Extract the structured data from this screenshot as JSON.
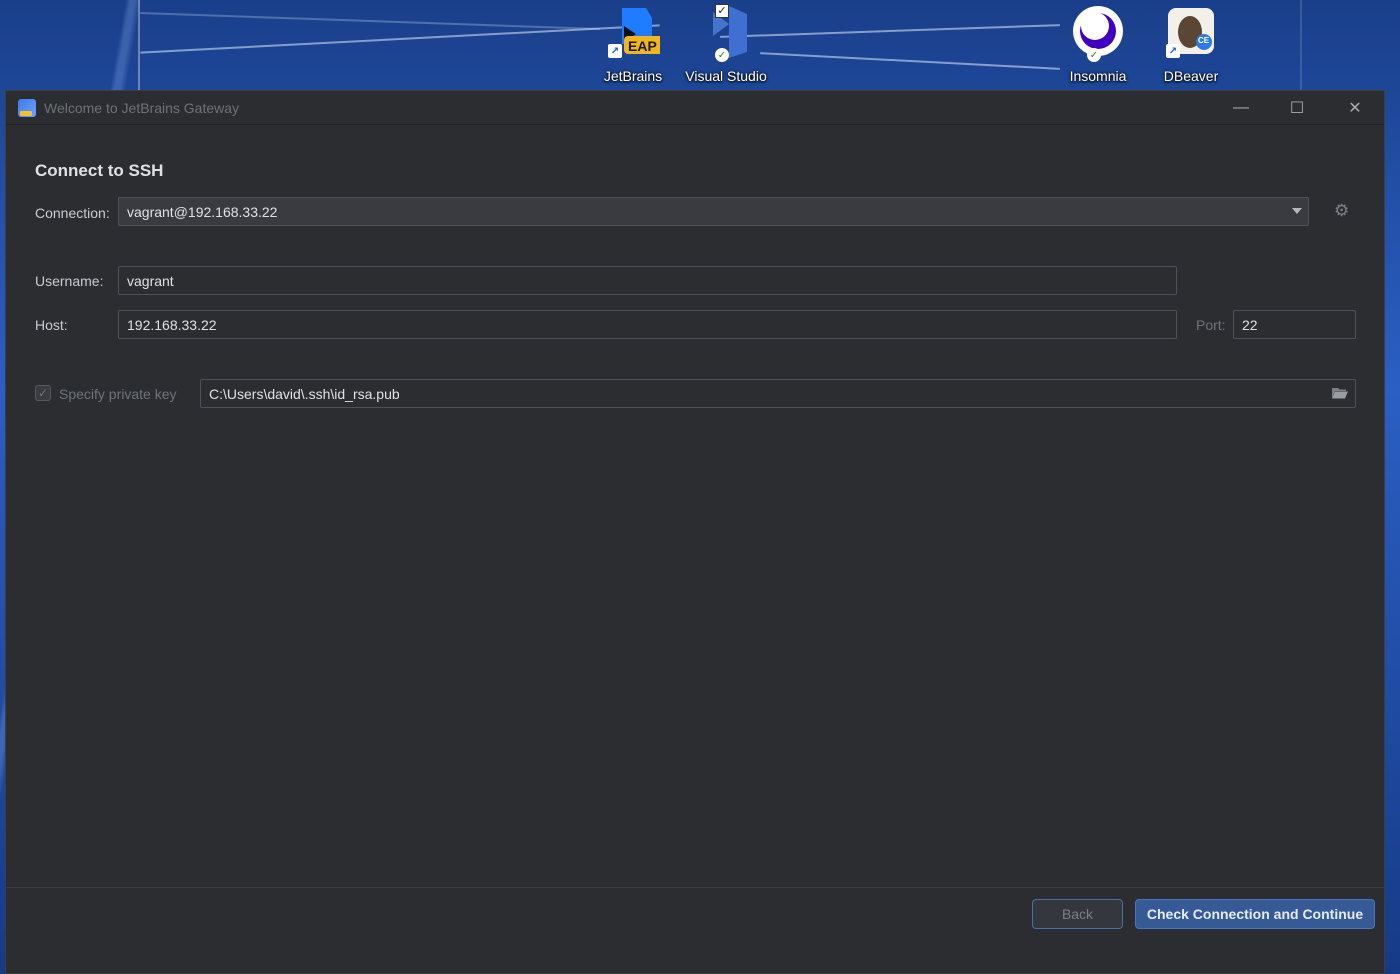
{
  "desktop": {
    "icons": [
      {
        "label": "JetBrains",
        "badge": "EAP",
        "icon": "jetbrains-gateway-icon"
      },
      {
        "label": "Visual Studio",
        "icon": "visual-studio-icon"
      },
      {
        "label": "Insomnia",
        "icon": "insomnia-icon"
      },
      {
        "label": "DBeaver",
        "icon": "dbeaver-icon",
        "badge": "CE"
      }
    ]
  },
  "window": {
    "title": "Welcome to JetBrains Gateway",
    "controls": {
      "minimize": "—",
      "maximize": "☐",
      "close": "✕"
    }
  },
  "form": {
    "heading": "Connect to SSH",
    "connection_label": "Connection:",
    "connection_value": "vagrant@192.168.33.22",
    "username_label": "Username:",
    "username_value": "vagrant",
    "host_label": "Host:",
    "host_value": "192.168.33.22",
    "port_label": "Port:",
    "port_value": "22",
    "private_key_label": "Specify private key",
    "private_key_checked": true,
    "private_key_path": "C:\\Users\\david\\.ssh\\id_rsa.pub"
  },
  "footer": {
    "back_label": "Back",
    "continue_label": "Check Connection and Continue"
  },
  "colors": {
    "window_bg": "#2b2d30",
    "field_border": "#4e5157",
    "primary_button": "#365a96",
    "eap_badge": "#f1b61f"
  }
}
